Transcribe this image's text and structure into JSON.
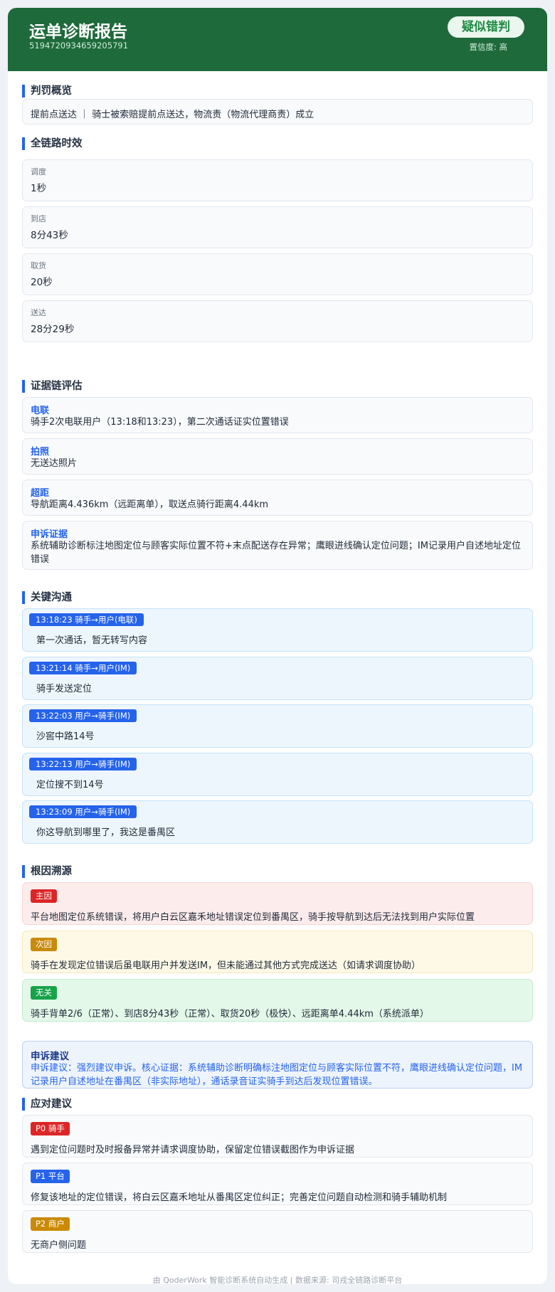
{
  "header": {
    "title": "运单诊断报告",
    "order_id": "5194720934659205791",
    "verdict": "疑似错判",
    "confidence": "置信度: 高"
  },
  "summary": {
    "title": "判罚概览",
    "text": "提前点送达 ｜ 骑士被索赔提前点送达，物流责（物流代理商责）成立"
  },
  "timeline": {
    "title": "全链路时效",
    "items": [
      {
        "label": "调度",
        "value": "1秒"
      },
      {
        "label": "到店",
        "value": "8分43秒"
      },
      {
        "label": "取货",
        "value": "20秒"
      },
      {
        "label": "送达",
        "value": "28分29秒"
      }
    ]
  },
  "evidence": {
    "title": "证据链评估",
    "items": [
      {
        "label": "电联",
        "value": "骑手2次电联用户（13:18和13:23），第二次通话证实位置错误"
      },
      {
        "label": "拍照",
        "value": "无送达照片"
      },
      {
        "label": "超距",
        "value": "导航距离4.436km（远距离单），取送点骑行距离4.44km"
      },
      {
        "label": "申诉证据",
        "value": "系统辅助诊断标注地图定位与顾客实际位置不符+末点配送存在异常；鹰眼进线确认定位问题；IM记录用户自述地址定位错误"
      }
    ]
  },
  "communication": {
    "title": "关键沟通",
    "items": [
      {
        "tag": "13:18:23  骑手→用户(电联)",
        "text": "第一次通话，暂无转写内容"
      },
      {
        "tag": "13:21:14  骑手→用户(IM)",
        "text": "骑手发送定位"
      },
      {
        "tag": "13:22:03  用户→骑手(IM)",
        "text": "沙窖中路14号"
      },
      {
        "tag": "13:22:13  用户→骑手(IM)",
        "text": "定位搜不到14号"
      },
      {
        "tag": "13:23:09  用户→骑手(IM)",
        "text": "你这导航到哪里了，我这是番禺区"
      }
    ]
  },
  "root_cause": {
    "title": "根因溯源",
    "items": [
      {
        "tag": "主因",
        "color": "#dc2626",
        "bg": "#fdecec",
        "border": "#f8d4d4",
        "text": "平台地图定位系统错误，将用户白云区嘉禾地址错误定位到番禺区，骑手按导航到达后无法找到用户实际位置"
      },
      {
        "tag": "次因",
        "color": "#c98a0b",
        "bg": "#fef9e7",
        "border": "#f7e7b7",
        "text": "骑手在发现定位错误后虽电联用户并发送IM，但未能通过其他方式完成送达（如请求调度协助）"
      },
      {
        "tag": "无关",
        "color": "#16a34a",
        "bg": "#e4f8e9",
        "border": "#c2ebcf",
        "text": "骑手背单2/6（正常）、到店8分43秒（正常）、取货20秒（极快）、远距离单4.44km（系统派单）"
      }
    ]
  },
  "appeal": {
    "title": "申诉建议",
    "text": "申诉建议：强烈建议申诉。核心证据：系统辅助诊断明确标注地图定位与顾客实际位置不符，鹰眼进线确认定位问题，IM记录用户自述地址在番禺区（非实际地址），通话录音证实骑手到达后发现位置错误。"
  },
  "advice": {
    "title": "应对建议",
    "items": [
      {
        "tag": "P0 骑手",
        "color": "#dc2626",
        "text": "遇到定位问题时及时报备异常并请求调度协助，保留定位错误截图作为申诉证据"
      },
      {
        "tag": "P1 平台",
        "color": "#2563eb",
        "text": "修复该地址的定位错误，将白云区嘉禾地址从番禺区定位纠正；完善定位问题自动检测和骑手辅助机制"
      },
      {
        "tag": "P2 商户",
        "color": "#ca8a04",
        "text": "无商户侧问题"
      }
    ]
  },
  "footer": {
    "text": "由 QoderWork 智能诊断系统自动生成 | 数据来源: 司戎全链路诊断平台"
  }
}
